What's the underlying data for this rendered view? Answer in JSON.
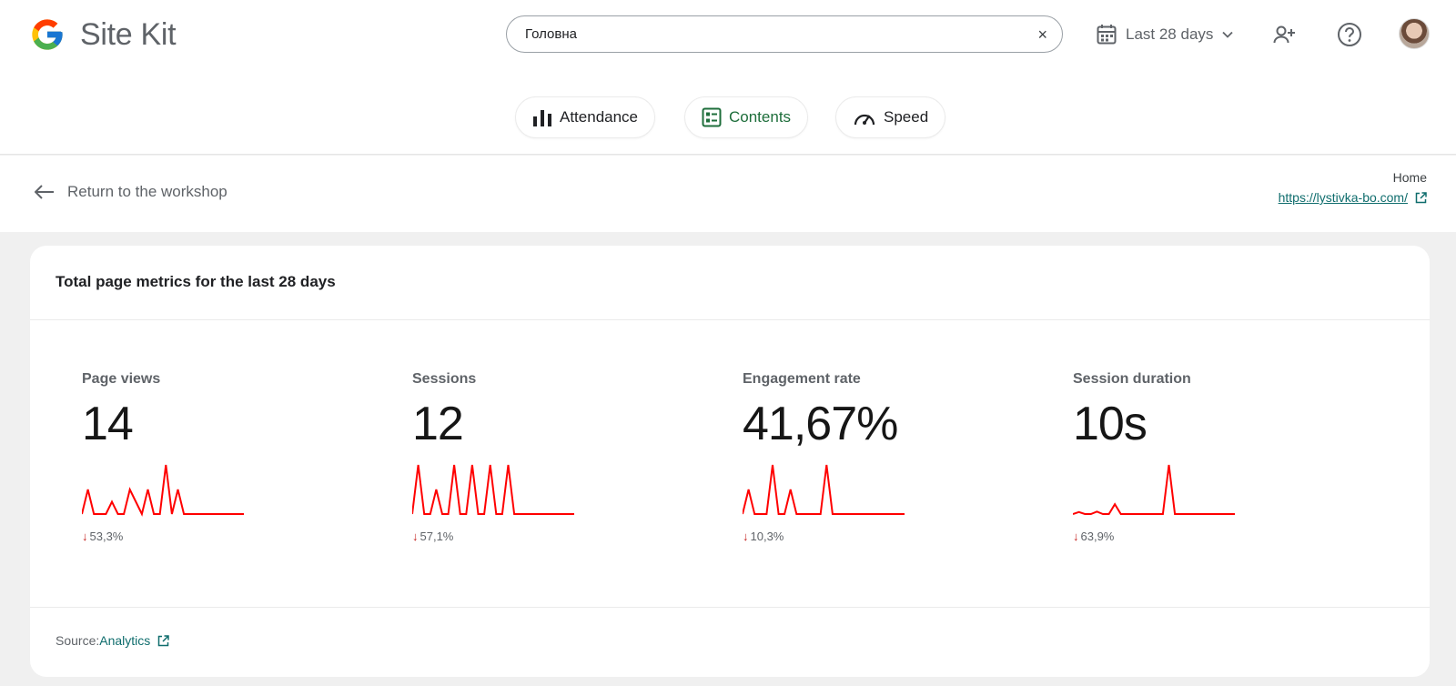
{
  "app": {
    "name": "Site Kit"
  },
  "search": {
    "value": "Головна",
    "clear_icon": "×"
  },
  "date_range": {
    "label": "Last 28 days"
  },
  "tabs": [
    {
      "label": "Attendance",
      "icon": "bar-chart-icon",
      "active": false
    },
    {
      "label": "Contents",
      "icon": "content-list-icon",
      "active": true
    },
    {
      "label": "Speed",
      "icon": "speedometer-icon",
      "active": false
    }
  ],
  "subheader": {
    "back_label": "Return to the workshop",
    "page_title": "Home",
    "page_url": "https://lystivka-bo.com/"
  },
  "card": {
    "title": "Total page metrics for the last 28 days",
    "source_label": "Source:",
    "source_link": "Analytics"
  },
  "metrics": [
    {
      "label": "Page views",
      "value": "14",
      "change": "53,3%",
      "direction": "down",
      "trend": [
        0,
        1,
        0,
        0,
        0,
        0.5,
        0,
        0,
        1,
        0.5,
        0,
        1,
        0,
        0,
        2,
        0,
        1,
        0,
        0,
        0,
        0,
        0,
        0,
        0,
        0,
        0,
        0,
        0
      ]
    },
    {
      "label": "Sessions",
      "value": "12",
      "change": "57,1%",
      "direction": "down",
      "trend": [
        0,
        1,
        0,
        0,
        0.5,
        0,
        0,
        1,
        0,
        0,
        1,
        0,
        0,
        1,
        0,
        0,
        1,
        0,
        0,
        0,
        0,
        0,
        0,
        0,
        0,
        0,
        0,
        0
      ]
    },
    {
      "label": "Engagement rate",
      "value": "41,67%",
      "change": "10,3%",
      "direction": "down",
      "trend": [
        0,
        0.5,
        0,
        0,
        0,
        1,
        0,
        0,
        0.5,
        0,
        0,
        0,
        0,
        0,
        1,
        0,
        0,
        0,
        0,
        0,
        0,
        0,
        0,
        0,
        0,
        0,
        0,
        0
      ]
    },
    {
      "label": "Session duration",
      "value": "10s",
      "change": "63,9%",
      "direction": "down",
      "trend": [
        0,
        0.04,
        0,
        0,
        0.05,
        0,
        0,
        0.2,
        0,
        0,
        0,
        0,
        0,
        0,
        0,
        0,
        1,
        0,
        0,
        0,
        0,
        0,
        0,
        0,
        0,
        0,
        0,
        0
      ]
    }
  ],
  "colors": {
    "sparkline": "#ff0000",
    "accent": "#1e6e3b",
    "link": "#0f6d6d",
    "negative": "#c5221f"
  }
}
